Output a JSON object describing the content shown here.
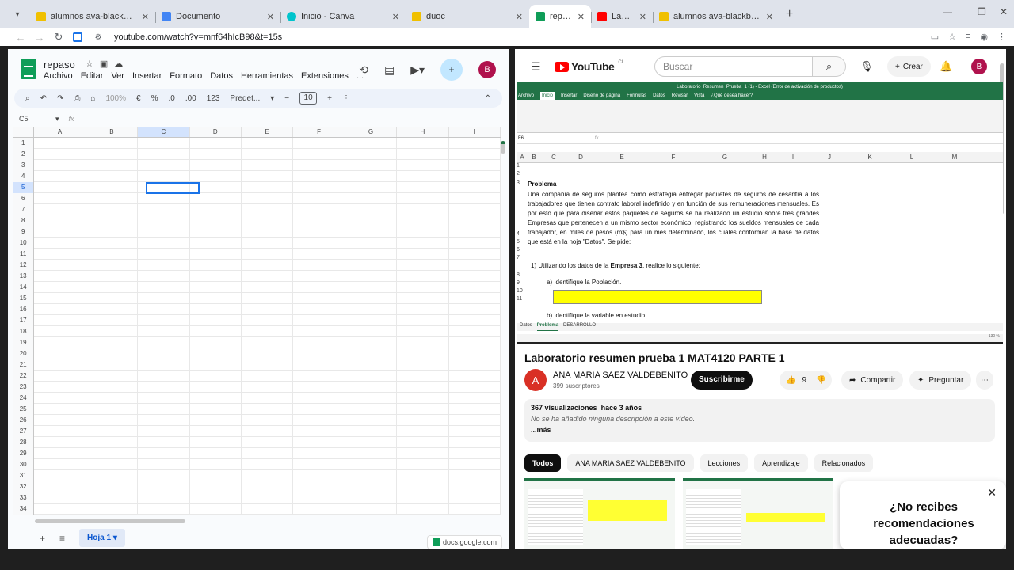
{
  "browser": {
    "tabs": [
      {
        "label": "alumnos ava-blackboard - duoc",
        "fav": "#f0c000",
        "active": false
      },
      {
        "label": "Documento",
        "fav": "#4285f4",
        "active": false
      },
      {
        "label": "Inicio - Canva",
        "fav": "#00c4cc",
        "active": false
      },
      {
        "label": "duoc",
        "fav": "#f0c000",
        "active": false
      },
      {
        "label": "repaso - I",
        "fav": "#0f9d58",
        "active": true
      },
      {
        "label": "Laborato",
        "fav": "#ff0000",
        "active": false
      },
      {
        "label": "alumnos ava-blackboard - duoc",
        "fav": "#f0c000",
        "active": false
      }
    ],
    "url": "youtube.com/watch?v=mnf64hIcB98&t=15s"
  },
  "sheets": {
    "title": "repaso",
    "menu": [
      "Archivo",
      "Editar",
      "Ver",
      "Insertar",
      "Formato",
      "Datos",
      "Herramientas",
      "Extensiones",
      "..."
    ],
    "avatar": "B",
    "toolbar": {
      "zoom": "100%",
      "currency": "€",
      "percent": "%",
      "dec_less": ".0",
      "dec_more": ".00",
      "numformat": "123",
      "font": "Predet...",
      "font_size": "10"
    },
    "name_box": "C5",
    "fx": "fx",
    "columns": [
      "A",
      "B",
      "C",
      "D",
      "E",
      "F",
      "G",
      "H",
      "I"
    ],
    "rows": [
      "1",
      "2",
      "3",
      "4",
      "5",
      "6",
      "7",
      "8",
      "9",
      "10",
      "11",
      "12",
      "13",
      "14",
      "15",
      "16",
      "17",
      "18",
      "19",
      "20",
      "21",
      "22",
      "23",
      "24",
      "25",
      "26",
      "27",
      "28",
      "29",
      "30",
      "31",
      "32",
      "33",
      "34"
    ],
    "sheet_tab": "Hoja 1",
    "docs_chip": "docs.google.com"
  },
  "youtube": {
    "search_placeholder": "Buscar",
    "create": "Crear",
    "country": "CL",
    "avatar": "B",
    "video": {
      "excel_title": "Laboratorio_Resumen_Prueba_1 (1) - Excel (Error de activación de productos)",
      "excel_tabs": [
        "Archivo",
        "Inicio",
        "Insertar",
        "Diseño de página",
        "Fórmulas",
        "Datos",
        "Revisar",
        "Vista",
        "¿Qué desea hacer?"
      ],
      "cell_ref": "F6",
      "col_letters": [
        "A",
        "B",
        "C",
        "D",
        "E",
        "F",
        "G",
        "H",
        "I",
        "J",
        "K",
        "L",
        "M"
      ],
      "problema": "Problema",
      "paragraph": "Una compañía de seguros plantea como estrategia entregar paquetes de seguros de cesantía a los trabajadores que tienen contrato laboral indefinido y en función de sus remuneraciones mensuales. Es por esto que para diseñar estos paquetes de seguros se ha realizado un estudio sobre tres grandes Empresas que pertenecen a un mismo sector económico, registrando los sueldos mensuales de cada trabajador, en miles de pesos (m$) para un mes determinado, los cuales conforman la base de datos que está en la hoja \"Datos\". Se pide:",
      "q1_prefix": "1) Utilizando los datos de la ",
      "q1_bold": "Empresa 3",
      "q1_suffix": ", realice lo siguiente:",
      "q1a": "a) Identifique la Población.",
      "q1b": "b) Identifique la variable en estudio",
      "sheet_tabs": [
        "Datos",
        "Problema",
        "DESARROLLO"
      ],
      "zoom": "130 %"
    },
    "title": "Laboratorio resumen prueba 1 MAT4120 PARTE 1",
    "channel": {
      "initial": "A",
      "name": "ANA MARIA SAEZ VALDEBENITO",
      "subs": "399 suscriptores"
    },
    "subscribe": "Suscribirme",
    "likes": "9",
    "share": "Compartir",
    "ask": "Preguntar",
    "desc": {
      "views": "367 visualizaciones",
      "ago": "hace 3 años",
      "empty": "No se ha añadido ninguna descripción a este vídeo.",
      "more": "...más"
    },
    "chips": [
      "Todos",
      "ANA MARIA SAEZ VALDEBENITO",
      "Lecciones",
      "Aprendizaje",
      "Relacionados"
    ],
    "popup": "¿No recibes recomendaciones adecuadas?"
  }
}
